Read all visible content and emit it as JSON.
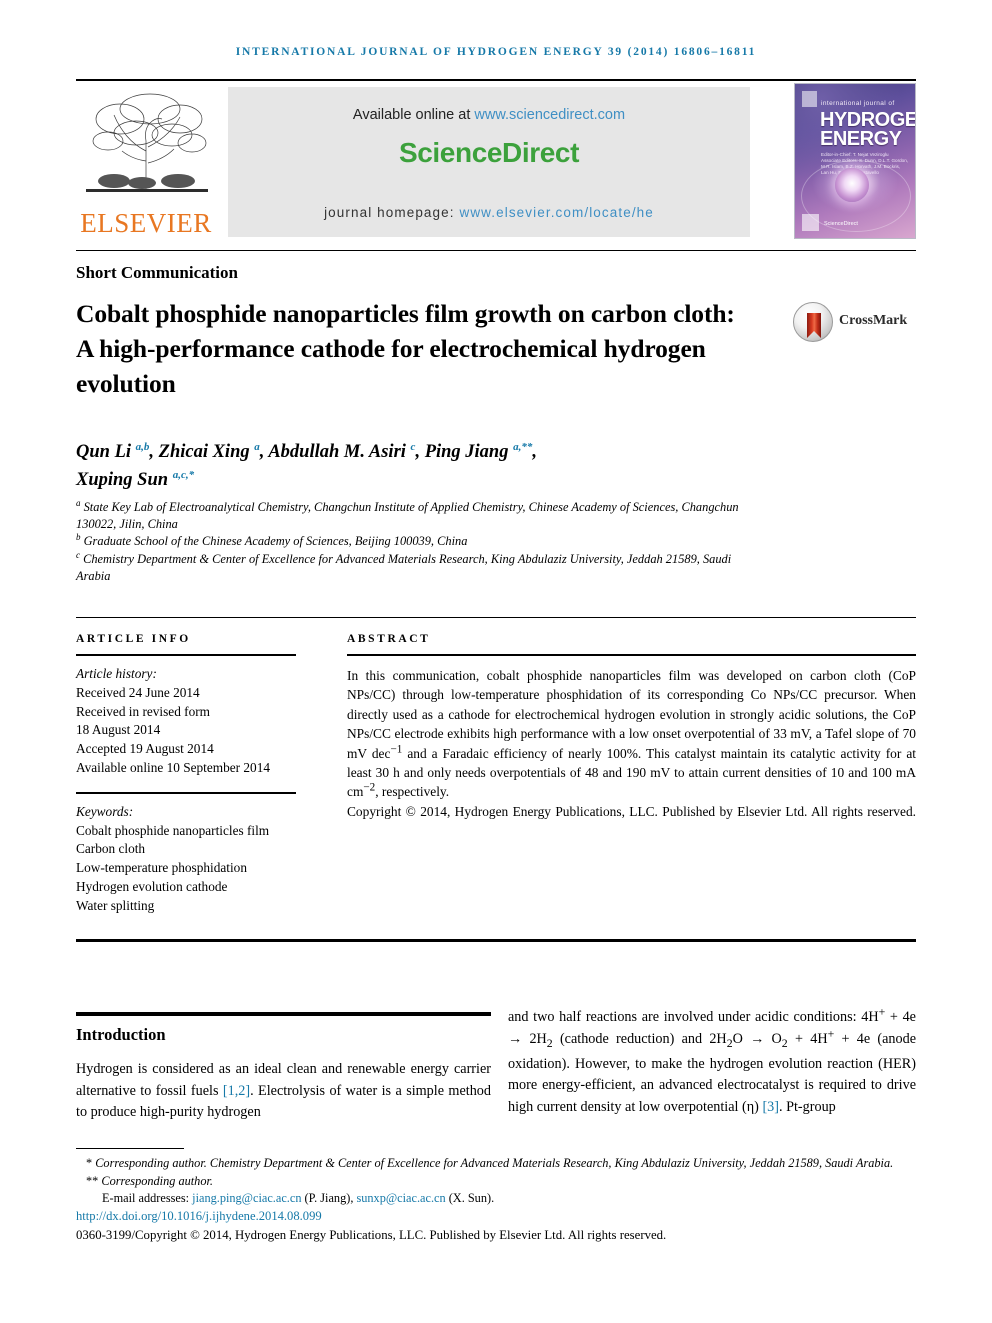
{
  "running_head": "International Journal of Hydrogen Energy 39 (2014) 16806–16811",
  "masthead": {
    "publisher_name": "ELSEVIER",
    "available_prefix": "Available online at ",
    "available_url": "www.sciencedirect.com",
    "sciencedirect_logo": "ScienceDirect",
    "homepage_prefix": "journal homepage: ",
    "homepage_url": "www.elsevier.com/locate/he",
    "cover": {
      "pre_title": "international journal of",
      "title_line1": "HYDROGEN",
      "title_line2": "ENERGY",
      "editors": "Editor-in-Chief: T. Nejat Veziroglu   Associate Editors: S. Dunn, D.L.T. Gordon, M.R. Islam, B.Z. Horvath, J.M. Bockris, Lan Hu, Frank D. Gustavello",
      "footer_mark": "ScienceDirect"
    }
  },
  "article": {
    "section_type": "Short Communication",
    "title": "Cobalt phosphide nanoparticles film growth on carbon cloth: A high-performance cathode for electrochemical hydrogen evolution",
    "crossmark_label": "CrossMark",
    "authors_line1": "Qun Li a,b, Zhicai Xing a, Abdullah M. Asiri c, Ping Jiang a,**,",
    "authors_line2": "Xuping Sun a,c,*",
    "affiliations": [
      "a State Key Lab of Electroanalytical Chemistry, Changchun Institute of Applied Chemistry, Chinese Academy of Sciences, Changchun 130022, Jilin, China",
      "b Graduate School of the Chinese Academy of Sciences, Beijing 100039, China",
      "c Chemistry Department & Center of Excellence for Advanced Materials Research, King Abdulaziz University, Jeddah 21589, Saudi Arabia"
    ]
  },
  "article_info": {
    "heading": "ARTICLE INFO",
    "history_label": "Article history:",
    "history": [
      "Received 24 June 2014",
      "Received in revised form",
      "18 August 2014",
      "Accepted 19 August 2014",
      "Available online 10 September 2014"
    ],
    "keywords_label": "Keywords:",
    "keywords": [
      "Cobalt phosphide nanoparticles film",
      "Carbon cloth",
      "Low-temperature phosphidation",
      "Hydrogen evolution cathode",
      "Water splitting"
    ]
  },
  "abstract": {
    "heading": "ABSTRACT",
    "body_part1": "In this communication, cobalt phosphide nanoparticles film was developed on carbon cloth (CoP NPs/CC) through low-temperature phosphidation of its corresponding Co NPs/CC precursor. When directly used as a cathode for electrochemical hydrogen evolution in strongly acidic solutions, the CoP NPs/CC electrode exhibits high performance with a low onset overpotential of 33 mV, a Tafel slope of 70 mV dec",
    "sup1": "−1",
    "body_part2": " and a Faradaic efficiency of nearly 100%. This catalyst maintain its catalytic activity for at least 30 h and only needs overpotentials of 48 and 190 mV to attain current densities of 10 and 100 mA cm",
    "sup2": "−2",
    "body_part3": ", respectively.",
    "copyright": "Copyright © 2014, Hydrogen Energy Publications, LLC. Published by Elsevier Ltd. All rights reserved."
  },
  "introduction": {
    "heading": "Introduction",
    "left_text_a": "Hydrogen is considered as an ideal clean and renewable energy carrier alternative to fossil fuels ",
    "left_ref1": "[1,2]",
    "left_text_b": ". Electrolysis of water is a simple method to produce high-purity hydrogen",
    "right_text_a": "and two half reactions are involved under acidic conditions: 4H",
    "right_sup1": "+",
    "right_text_b": " + 4e → 2H",
    "right_sub1": "2",
    "right_text_c": " (cathode reduction) and 2H",
    "right_sub2": "2",
    "right_text_d": "O → O",
    "right_sub3": "2",
    "right_text_e": " + 4H",
    "right_sup2": "+",
    "right_text_f": " + 4e (anode oxidation). However, to make the hydrogen evolution reaction (HER) more energy-efficient, an advanced electrocatalyst is required to drive high current density at low overpotential (η) ",
    "right_ref2": "[3]",
    "right_text_g": ". Pt-group"
  },
  "footer": {
    "corr1_marker": "*",
    "corr1": " Corresponding author. Chemistry Department & Center of Excellence for Advanced Materials Research, King Abdulaziz University, Jeddah 21589, Saudi Arabia.",
    "corr2_marker": "**",
    "corr2": " Corresponding author.",
    "email_label": "E-mail addresses: ",
    "email1": "jiang.ping@ciac.ac.cn",
    "email1_who": " (P. Jiang), ",
    "email2": "sunxp@ciac.ac.cn",
    "email2_who": " (X. Sun).",
    "doi": "http://dx.doi.org/10.1016/j.ijhydene.2014.08.099",
    "issn_line": "0360-3199/Copyright © 2014, Hydrogen Energy Publications, LLC. Published by Elsevier Ltd. All rights reserved."
  },
  "colors": {
    "link_blue": "#1679a8",
    "sd_green": "#3ca13c",
    "sd_link": "#3f8fc4",
    "elsevier_orange": "#E87722"
  }
}
